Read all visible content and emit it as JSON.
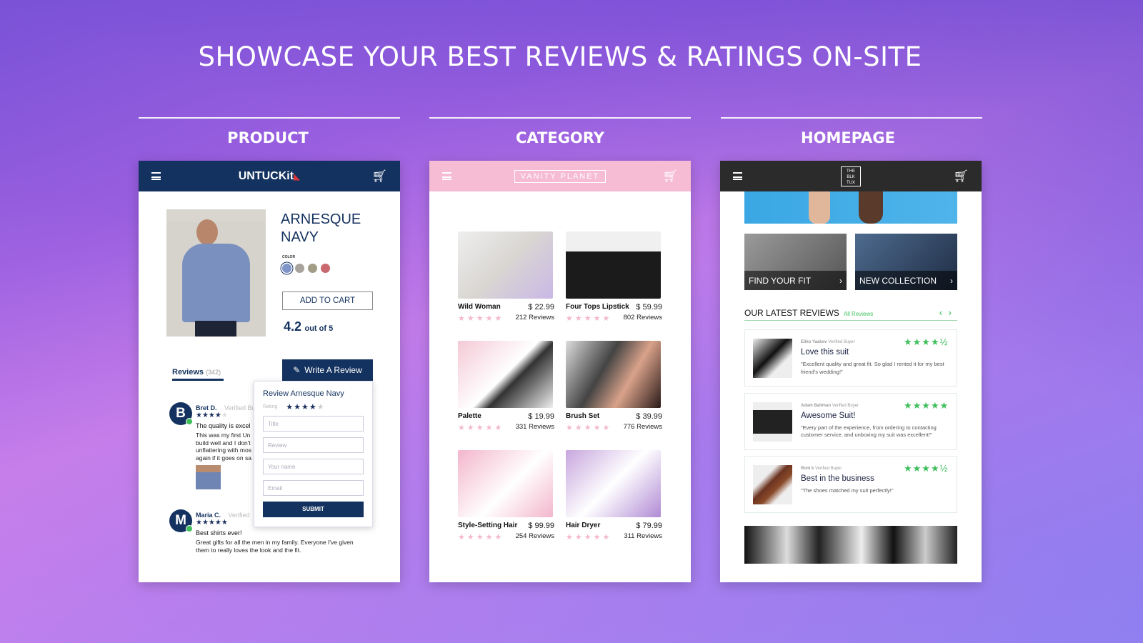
{
  "headline": "SHOWCASE YOUR BEST REVIEWS & RATINGS ON-SITE",
  "sections": [
    "PRODUCT",
    "CATEGORY",
    "HOMEPAGE"
  ],
  "product": {
    "brand": "UNTUCKit",
    "header_color": "#14325f",
    "title_line1": "ARNESQUE",
    "title_line2": "NAVY",
    "color_label": "COLOR",
    "swatches": [
      "#7f94c8",
      "#a8a49c",
      "#a19d86",
      "#c9686e"
    ],
    "add_to_cart": "ADD TO CART",
    "rating": "4.2",
    "rating_suffix": "out of 5",
    "reviews_tab": "Reviews",
    "reviews_count": "(342)",
    "write_review": "Write A Review",
    "popup": {
      "title": "Review Arnesque Navy",
      "rating_label": "Rating",
      "rating_stars": 4,
      "title_ph": "Title",
      "review_ph": "Review",
      "name_ph": "Your name",
      "email_ph": "Email",
      "submit": "SUBMIT"
    },
    "reviews": [
      {
        "initial": "B",
        "name": "Bret D.",
        "verified": "Verified Buyer",
        "stars": "★★★★",
        "empty": "★",
        "headline": "The quality is excel",
        "body": [
          "This was my first Un",
          "build well and I don't",
          "unflattering with mos",
          "again if it goes on sa"
        ]
      },
      {
        "initial": "M",
        "name": "Maria C.",
        "verified": "Verified",
        "stars": "★★★★★",
        "empty": "",
        "headline": "Best shirts ever!",
        "body": [
          "Great gifts for all the men in my family. Everyone I've given",
          "them to really loves the look and the fit."
        ]
      }
    ]
  },
  "category": {
    "brand": "VANITY PLANET",
    "header_color": "#f5bcd3",
    "products": [
      {
        "name": "Wild Woman",
        "price": "$ 22.99",
        "reviews": "212 Reviews",
        "img": "linear-gradient(135deg,#eee,#d9d6d2 50%,#c9b8e6)"
      },
      {
        "name": "Four Tops Lipstick",
        "price": "$ 59.99",
        "reviews": "802 Reviews",
        "img": "linear-gradient(180deg,#f0f0f0 0 30%,#1b1b1b 30%)"
      },
      {
        "name": "Palette",
        "price": "$ 19.99",
        "reviews": "331 Reviews",
        "img": "linear-gradient(135deg,#f4c9d6,#fff 50%,#333 60%,#eee)"
      },
      {
        "name": "Brush Set",
        "price": "$ 39.99",
        "reviews": "776 Reviews",
        "img": "linear-gradient(120deg,#ddd,#444 40%,#d9a28a 65%,#2a1a18)"
      },
      {
        "name": "Style-Setting Hair",
        "price": "$ 99.99",
        "reviews": "254 Reviews",
        "img": "linear-gradient(135deg,#f3b6cc,#fff 55%,#f3b6cc)"
      },
      {
        "name": "Hair Dryer",
        "price": "$ 79.99",
        "reviews": "311 Reviews",
        "img": "linear-gradient(135deg,#c7a6de,#fff 50%,#b08ad4)"
      }
    ]
  },
  "homepage": {
    "brand": "THE BLK TUX",
    "header_color": "#2b2b2b",
    "tiles": [
      "FIND YOUR FIT",
      "NEW COLLECTION"
    ],
    "latest_title": "OUR LATEST REVIEWS",
    "all_reviews": "All Reviews",
    "accent": "#3fbf5c",
    "reviews": [
      {
        "author": "Eliko Yaakov",
        "verified": "Verified Buyer",
        "rating": 4.5,
        "stars": "★★★★½",
        "title": "Love this suit",
        "body": "\"Excellent quality and great fit. So glad I rented it for my best friend's wedding!\""
      },
      {
        "author": "Adam Baltman",
        "verified": "Verified Buyer",
        "rating": 5,
        "stars": "★★★★★",
        "title": "Awesome Suit!",
        "body": "\"Every part of the experience, from ordering to contacting customer service, and unboxing my suit was excellent!\""
      },
      {
        "author": "Roni k",
        "verified": "Verified Buyer",
        "rating": 4.5,
        "stars": "★★★★½",
        "title": "Best in the business",
        "body": "\"The shoes matched my suit perfectly!\""
      }
    ]
  }
}
